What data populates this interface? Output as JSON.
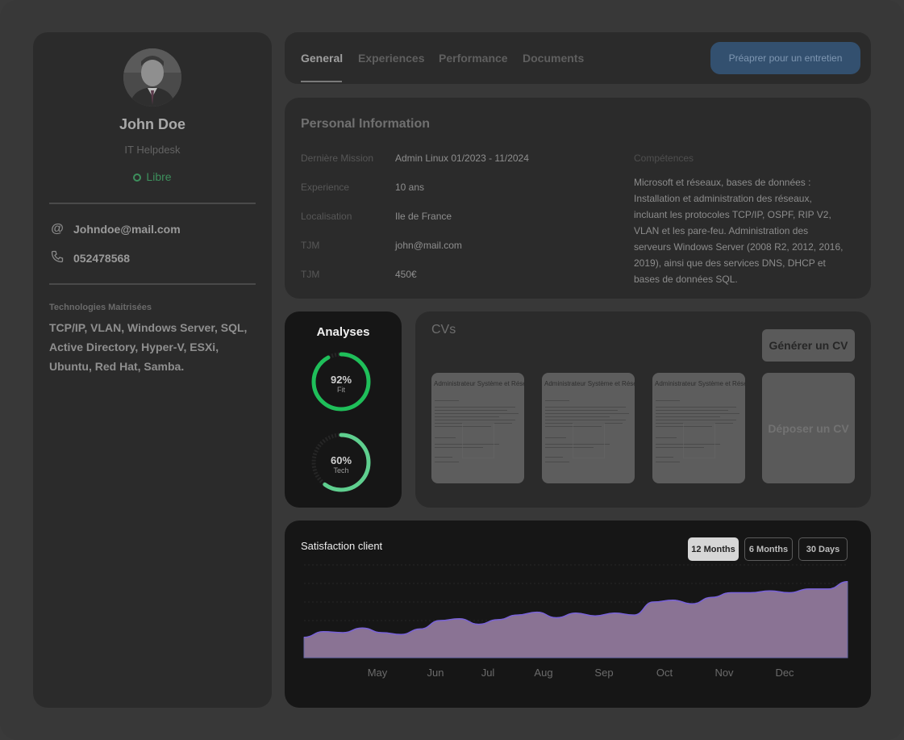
{
  "profile": {
    "name": "John Doe",
    "role": "IT Helpdesk",
    "status": "Libre",
    "email": "Johndoe@mail.com",
    "phone": "052478568",
    "tech_title": "Technologies Maitrisées",
    "tech_text": "TCP/IP, VLAN, Windows Server, SQL, Active Directory, Hyper-V, ESXi, Ubuntu, Red Hat, Samba."
  },
  "tabs": [
    {
      "label": "General"
    },
    {
      "label": "Experiences"
    },
    {
      "label": "Performance"
    },
    {
      "label": "Documents"
    }
  ],
  "prep_button": "Préaprer pour un entretien",
  "personal_info": {
    "title": "Personal Information",
    "rows": [
      {
        "label": "Dernière Mission",
        "value": "Admin  Linux   01/2023 - 11/2024"
      },
      {
        "label": "Experience",
        "value": "10 ans"
      },
      {
        "label": "Localisation",
        "value": "Ile de France"
      },
      {
        "label": "TJM",
        "value": "john@mail.com"
      },
      {
        "label": "TJM",
        "value": "450€"
      }
    ],
    "competences_title": "Compétences",
    "competences_text": "Microsoft et réseaux, bases de données : Installation et administration des réseaux, incluant les protocoles TCP/IP, OSPF, RIP V2, VLAN et les pare-feu. Administration des serveurs Windows Server (2008 R2, 2012, 2016, 2019), ainsi que des services DNS, DHCP et bases de données SQL."
  },
  "analyses": {
    "title": "Analyses",
    "items": [
      {
        "pct": "92%",
        "label": "Fit",
        "value": 0.92,
        "color": "#1fbf5a"
      },
      {
        "pct": "60%",
        "label": "Tech",
        "value": 0.6,
        "color": "#5fcf8f"
      }
    ]
  },
  "cvs": {
    "title": "CVs",
    "generate_button": "Générer un CV",
    "drop_label": "Déposer un CV",
    "thumbs": [
      {
        "title": "Administrateur Système et Réseau"
      },
      {
        "title": "Administrateur Système et Réseau"
      },
      {
        "title": "Administrateur Système et Réseau"
      }
    ]
  },
  "satisfaction": {
    "title": "Satisfaction client",
    "ranges": [
      "12 Months",
      "6 Months",
      "30 Days"
    ],
    "active_range": "12 Months"
  },
  "chart_data": {
    "type": "area",
    "title": "Satisfaction client",
    "categories": [
      "May",
      "Jun",
      "Jul",
      "Aug",
      "Sep",
      "Oct",
      "Nov",
      "Dec"
    ],
    "series": [
      {
        "values": [
          22,
          28,
          27,
          32,
          27,
          25,
          31,
          40,
          42,
          36,
          41,
          46,
          49,
          43,
          48,
          45,
          48,
          46,
          60,
          62,
          58,
          65,
          70,
          70,
          72,
          70,
          74,
          74,
          82
        ]
      }
    ],
    "x_range": [
      "Apr",
      "Dec"
    ],
    "ylim": [
      0,
      100
    ],
    "fill_color": "#8a7394",
    "line_color": "#7a63d9",
    "grid": true
  }
}
